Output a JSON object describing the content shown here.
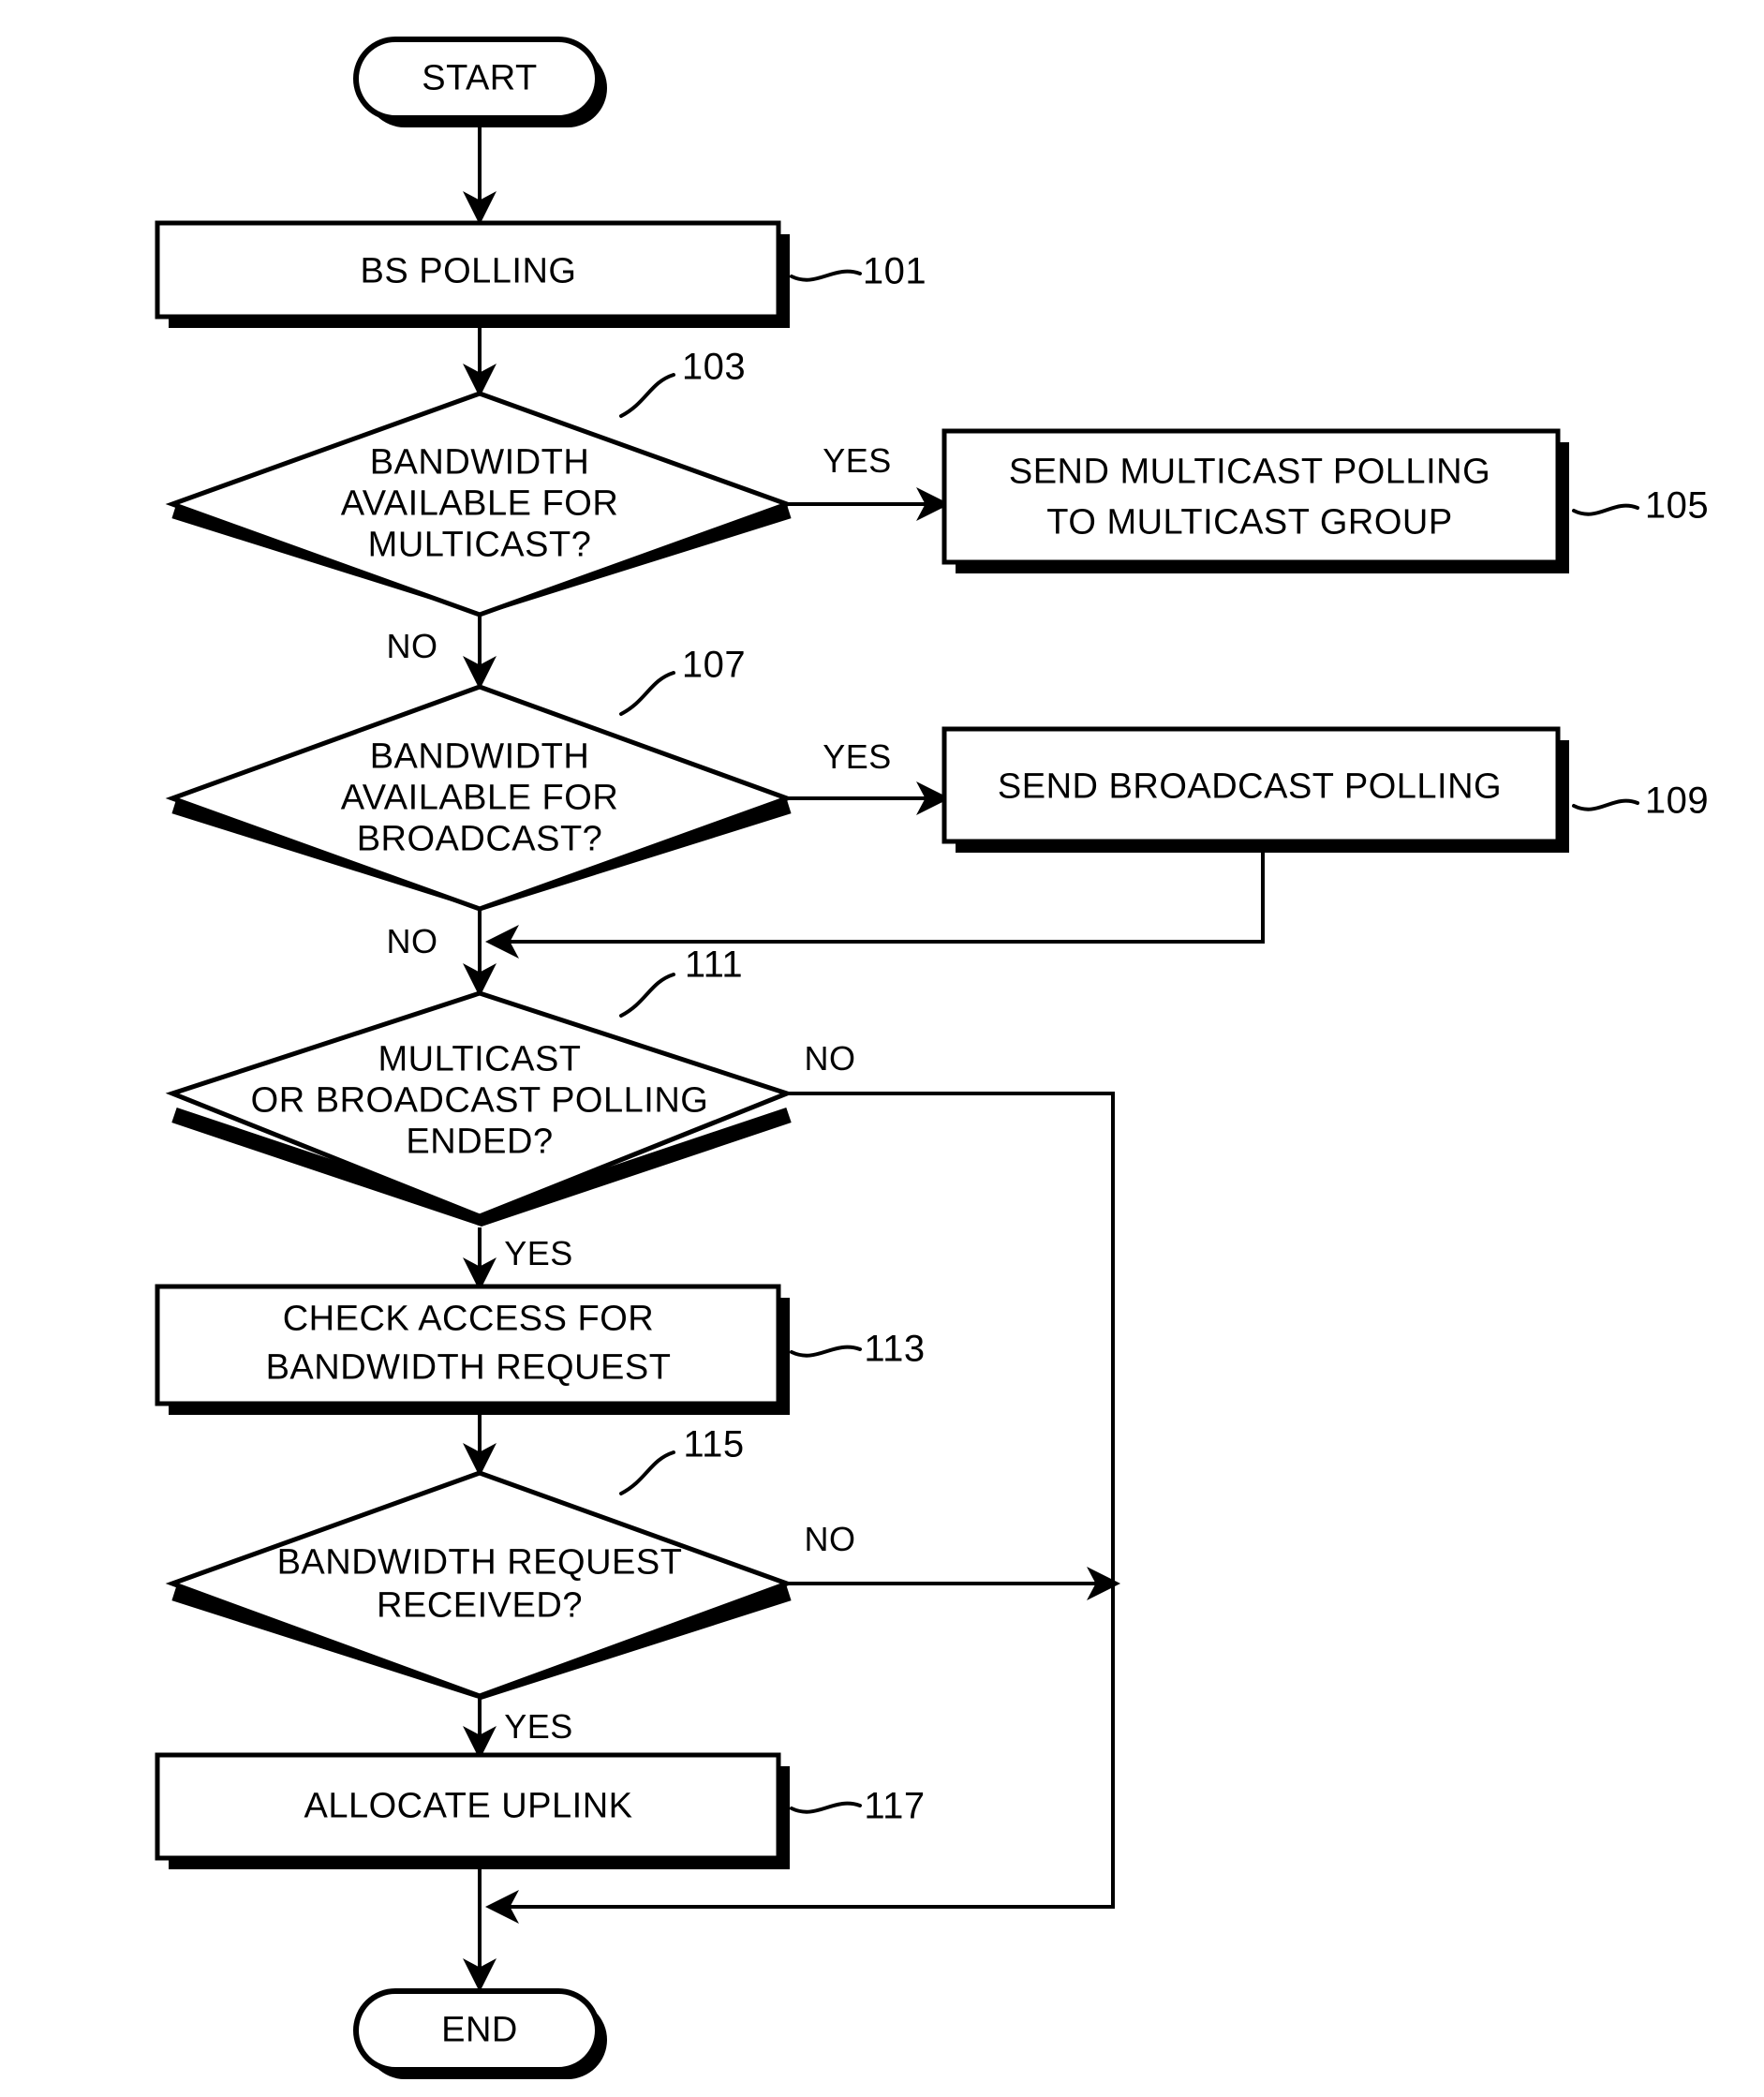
{
  "figure": {
    "type": "flowchart",
    "title": "BS polling and uplink bandwidth allocation flowchart",
    "orientation": "vertical",
    "line_color": "#000000",
    "fill_color": "#ffffff",
    "background": "#ffffff"
  },
  "nodes": {
    "start": {
      "label": "START",
      "shape": "terminator",
      "ref": ""
    },
    "bs_polling": {
      "label": "BS POLLING",
      "shape": "process",
      "ref": "101"
    },
    "bw_multicast": {
      "line1": "BANDWIDTH",
      "line2": "AVAILABLE FOR",
      "line3": "MULTICAST?",
      "shape": "decision",
      "ref": "103"
    },
    "send_multicast": {
      "line1": "SEND MULTICAST POLLING",
      "line2": "TO MULTICAST GROUP",
      "shape": "process",
      "ref": "105"
    },
    "bw_broadcast": {
      "line1": "BANDWIDTH",
      "line2": "AVAILABLE FOR",
      "line3": "BROADCAST?",
      "shape": "decision",
      "ref": "107"
    },
    "send_broadcast": {
      "label": "SEND BROADCAST POLLING",
      "shape": "process",
      "ref": "109"
    },
    "polling_ended": {
      "line1": "MULTICAST",
      "line2": "OR BROADCAST POLLING",
      "line3": "ENDED?",
      "shape": "decision",
      "ref": "111"
    },
    "check_access": {
      "line1": "CHECK ACCESS FOR",
      "line2": "BANDWIDTH REQUEST",
      "shape": "process",
      "ref": "113"
    },
    "bw_request": {
      "line1": "BANDWIDTH REQUEST",
      "line2": "RECEIVED?",
      "shape": "decision",
      "ref": "115"
    },
    "allocate_uplink": {
      "label": "ALLOCATE UPLINK",
      "shape": "process",
      "ref": "117"
    },
    "end": {
      "label": "END",
      "shape": "terminator",
      "ref": ""
    }
  },
  "branch_labels": {
    "multicast_yes": "YES",
    "multicast_no": "NO",
    "broadcast_yes": "YES",
    "broadcast_no": "NO",
    "ended_no": "NO",
    "ended_yes": "YES",
    "request_no": "NO",
    "request_yes": "YES"
  },
  "refs": {
    "r101": "101",
    "r103": "103",
    "r105": "105",
    "r107": "107",
    "r109": "109",
    "r111": "111",
    "r113": "113",
    "r115": "115",
    "r117": "117"
  }
}
